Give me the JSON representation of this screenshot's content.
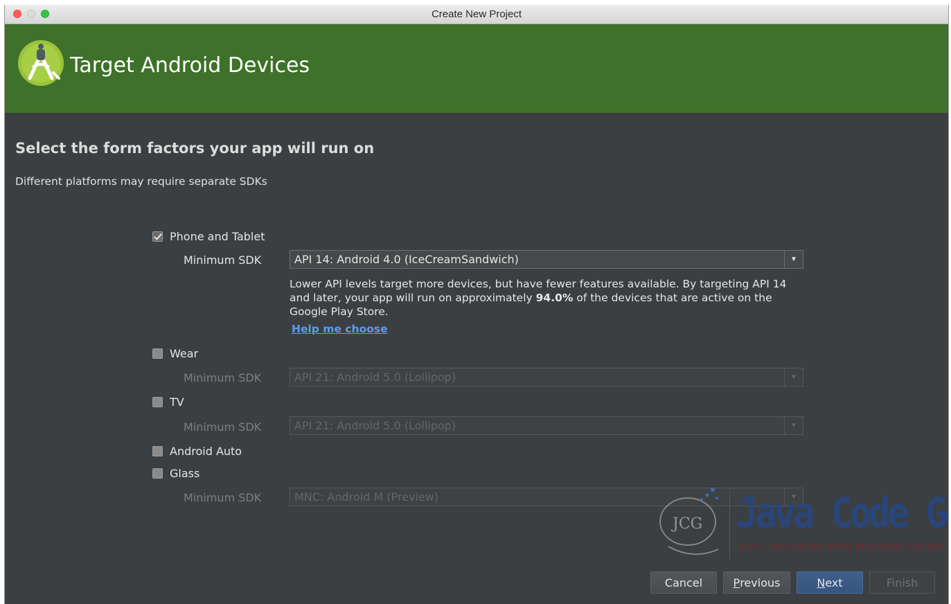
{
  "window": {
    "title": "Create New Project"
  },
  "header": {
    "title": "Target Android Devices",
    "icon": "android-studio-logo",
    "bg_color": "#3e7129"
  },
  "main": {
    "heading": "Select the form factors your app will run on",
    "subheading": "Different platforms may require separate SDKs",
    "phone_tablet": {
      "label": "Phone and Tablet",
      "checked": true,
      "sdk_label": "Minimum SDK",
      "sdk_value": "API 14: Android 4.0 (IceCreamSandwich)",
      "info_pre": "Lower API levels target more devices, but have fewer features available. By targeting API 14 and later, your app will run on approximately ",
      "info_percent": "94.0%",
      "info_post": " of the devices that are active on the Google Play Store.",
      "help_link": "Help me choose"
    },
    "wear": {
      "label": "Wear",
      "checked": false,
      "sdk_label": "Minimum SDK",
      "sdk_value": "API 21: Android 5.0 (Lollipop)"
    },
    "tv": {
      "label": "TV",
      "checked": false,
      "sdk_label": "Minimum SDK",
      "sdk_value": "API 21: Android 5.0 (Lollipop)"
    },
    "auto": {
      "label": "Android Auto",
      "checked": false
    },
    "glass": {
      "label": "Glass",
      "checked": false,
      "sdk_label": "Minimum SDK",
      "sdk_value": "MNC: Android M (Preview)"
    }
  },
  "watermark": {
    "badge": "JCG",
    "title": "Java Code Geeks",
    "subtitle": "JAVA 2 JAVA DEVELOPERS RESOURCE CENTER"
  },
  "buttons": {
    "cancel": "Cancel",
    "previous_mnemonic": "P",
    "previous_rest": "revious",
    "next_mnemonic": "N",
    "next_rest": "ext",
    "finish": "Finish"
  }
}
